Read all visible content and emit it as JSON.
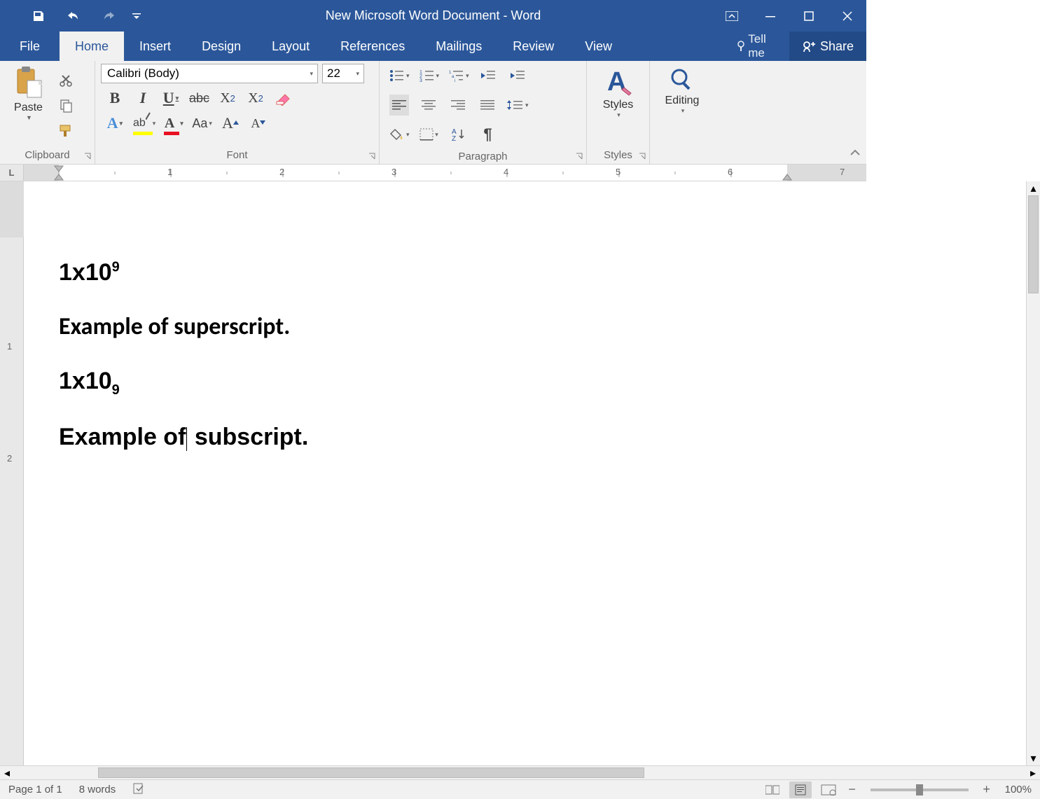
{
  "title": "New Microsoft Word Document - Word",
  "tabs": {
    "file": "File",
    "home": "Home",
    "insert": "Insert",
    "design": "Design",
    "layout": "Layout",
    "references": "References",
    "mailings": "Mailings",
    "review": "Review",
    "view": "View"
  },
  "tellme": "Tell me",
  "share": "Share",
  "ribbon": {
    "clipboard": {
      "label": "Clipboard",
      "paste": "Paste"
    },
    "font": {
      "label": "Font",
      "name": "Calibri (Body)",
      "size": "22"
    },
    "paragraph": {
      "label": "Paragraph"
    },
    "styles": {
      "label": "Styles",
      "btn": "Styles"
    },
    "editing": {
      "label": "",
      "btn": "Editing"
    }
  },
  "document": {
    "line1_base": "1x10",
    "line1_sup": "9",
    "line2": "Example of superscript.",
    "line3_base": "1x10",
    "line3_sub": "9",
    "line4": "Example of subscript."
  },
  "status": {
    "page": "Page 1 of 1",
    "words": "8 words",
    "zoom": "100%"
  },
  "ruler_marks": [
    "1",
    "2",
    "3",
    "4",
    "5",
    "6",
    "7"
  ]
}
